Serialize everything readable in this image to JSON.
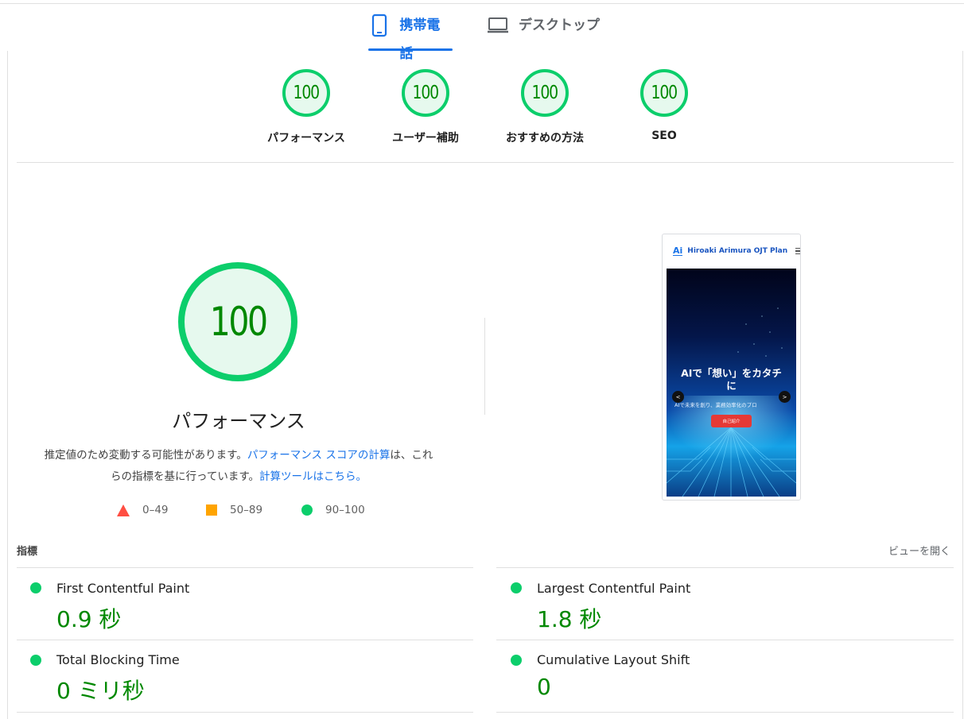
{
  "tabs": [
    {
      "label": "携帯電話",
      "icon": "smartphone-icon",
      "active": true
    },
    {
      "label": "デスクトップ",
      "icon": "laptop-icon",
      "active": false
    }
  ],
  "categories": [
    {
      "score": "100",
      "label": "パフォーマンス"
    },
    {
      "score": "100",
      "label": "ユーザー補助"
    },
    {
      "score": "100",
      "label": "おすすめの方法"
    },
    {
      "score": "100",
      "label": "SEO"
    }
  ],
  "performance": {
    "score": "100",
    "title": "パフォーマンス",
    "desc_part1": "推定値のため変動する可能性があります。",
    "desc_link1": "パフォーマンス スコアの計算",
    "desc_part2": "は、これらの指標を基に行っています。",
    "desc_link2": "計算ツールはこちら。"
  },
  "legend": {
    "fail": "0–49",
    "average": "50–89",
    "pass": "90–100"
  },
  "colors": {
    "pass": "#0cce6b",
    "average": "#ffa400",
    "fail": "#ff4e42",
    "accent": "#1a73e8",
    "score_text": "#008800"
  },
  "screenshot": {
    "logo": "Ai",
    "site_title": "Hiroaki Arimura OJT Plan",
    "hero_title_line1": "AIで「想い」をカタチ",
    "hero_title_line2": "に",
    "hero_subtitle": "AIで未来を創り、業務効率化のプロ",
    "hero_button": "自己紹介",
    "prev": "<",
    "next": ">"
  },
  "metrics": {
    "title": "指標",
    "view_toggle": "ビューを開く",
    "items": [
      {
        "name": "First Contentful Paint",
        "value": "0.9 秒"
      },
      {
        "name": "Largest Contentful Paint",
        "value": "1.8 秒"
      },
      {
        "name": "Total Blocking Time",
        "value": "0 ミリ秒"
      },
      {
        "name": "Cumulative Layout Shift",
        "value": "0"
      }
    ]
  }
}
